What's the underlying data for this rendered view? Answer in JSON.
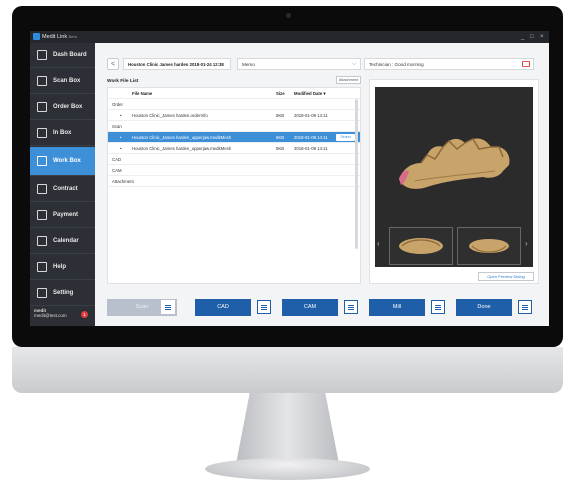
{
  "app": {
    "title": "Medit Link",
    "title_suffix": "Beta"
  },
  "window_controls": [
    "_",
    "□",
    "×"
  ],
  "sidebar": {
    "items": [
      {
        "label": "Dash Board",
        "active": false
      },
      {
        "label": "Scan Box",
        "active": false
      },
      {
        "label": "Order Box",
        "active": false
      },
      {
        "label": "In Box",
        "active": false
      },
      {
        "label": "Work Box",
        "active": true
      },
      {
        "label": "Contract",
        "active": false
      },
      {
        "label": "Payment",
        "active": false
      },
      {
        "label": "Calendar",
        "active": false
      },
      {
        "label": "Help",
        "active": false
      },
      {
        "label": "Setting",
        "active": false
      }
    ],
    "user_name": "medit",
    "user_email": "medit@test.com",
    "badge_count": "1"
  },
  "case_header": {
    "back_label": "<",
    "clinic": "Houston Clinic",
    "patient": "James harden",
    "date": "2018-01-24 12:38",
    "memo_placeholder": "Memo",
    "technician_message": "Technician : Good morning"
  },
  "work_file_list": {
    "title": "Work File List",
    "attachment_button": "Attachment",
    "columns": [
      "File Name",
      "Size",
      "Modified Date ▾"
    ],
    "rows": [
      {
        "type": "group",
        "name": "Order"
      },
      {
        "type": "file",
        "bullet": "•",
        "name": "Houston Clinic_James harden.orderInfo",
        "size": "5KB",
        "date": "2018-01-09 14:11",
        "selected": false
      },
      {
        "type": "group",
        "name": "Scan"
      },
      {
        "type": "file",
        "bullet": "•",
        "name": "Houston Clinic_James harden_upperjaw.meditMesh",
        "size": "5KB",
        "date": "2018-01-09 14:11",
        "selected": true
      },
      {
        "type": "file",
        "bullet": "•",
        "name": "Houston Clinic_James harden_upperjaw.meditMesh",
        "size": "5KB",
        "date": "2018-01-09 14:11",
        "selected": false
      },
      {
        "type": "group",
        "name": "CAD"
      },
      {
        "type": "group",
        "name": "CAM"
      },
      {
        "type": "group",
        "name": "Attachment"
      }
    ],
    "select_label": "Select"
  },
  "preview": {
    "open_button": "Open Preview Dialog",
    "prev": "‹",
    "next": "›"
  },
  "steps": [
    {
      "label": "Scan",
      "state": "done"
    },
    {
      "label": "CAD",
      "state": "pending"
    },
    {
      "label": "CAM",
      "state": "pending"
    },
    {
      "label": "Mill",
      "state": "pending"
    },
    {
      "label": "Done",
      "state": "pending"
    }
  ],
  "colors": {
    "accent": "#3d8fd8",
    "step": "#1f5ea8",
    "sidebar": "#2c2f35"
  }
}
